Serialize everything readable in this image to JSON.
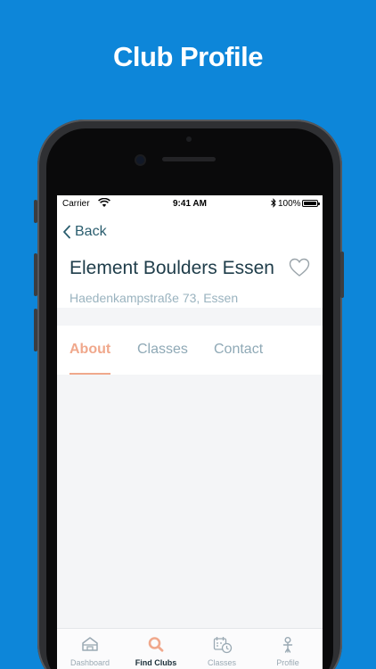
{
  "promo": {
    "title": "Club Profile"
  },
  "status_bar": {
    "carrier": "Carrier",
    "time": "9:41 AM",
    "battery": "100%"
  },
  "nav": {
    "back_label": "Back"
  },
  "club": {
    "name": "Element Boulders Essen",
    "address": "Haedenkampstraße 73, Essen"
  },
  "tabs": [
    {
      "label": "About",
      "active": true
    },
    {
      "label": "Classes",
      "active": false
    },
    {
      "label": "Contact",
      "active": false
    }
  ],
  "tab_bar": {
    "items": [
      {
        "label": "Dashboard",
        "icon": "house-icon",
        "active": false
      },
      {
        "label": "Find Clubs",
        "icon": "search-icon",
        "active": true
      },
      {
        "label": "Classes",
        "icon": "calendar-clock-icon",
        "active": false
      },
      {
        "label": "Profile",
        "icon": "person-icon",
        "active": false
      }
    ]
  },
  "colors": {
    "background": "#0d86d9",
    "accent": "#f0a88c",
    "primary_text": "#1f3d4a",
    "link": "#2a5d6e",
    "muted": "#9ab3bf"
  }
}
